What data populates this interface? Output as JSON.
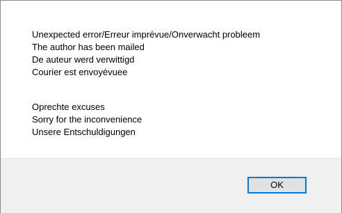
{
  "dialog": {
    "message_block_1": [
      "Unexpected error/Erreur imprévue/Onverwacht probleem",
      "The author has been mailed",
      "De auteur werd verwittigd",
      "Courier est envoyévuee"
    ],
    "message_block_2": [
      "Oprechte excuses",
      "Sorry for the inconvenience",
      "Unsere Entschuldigungen"
    ],
    "ok_label": "OK"
  },
  "colors": {
    "button_border": "#0078d7",
    "button_fill": "#e1e1e1",
    "footer_background": "#f0f0f0"
  }
}
